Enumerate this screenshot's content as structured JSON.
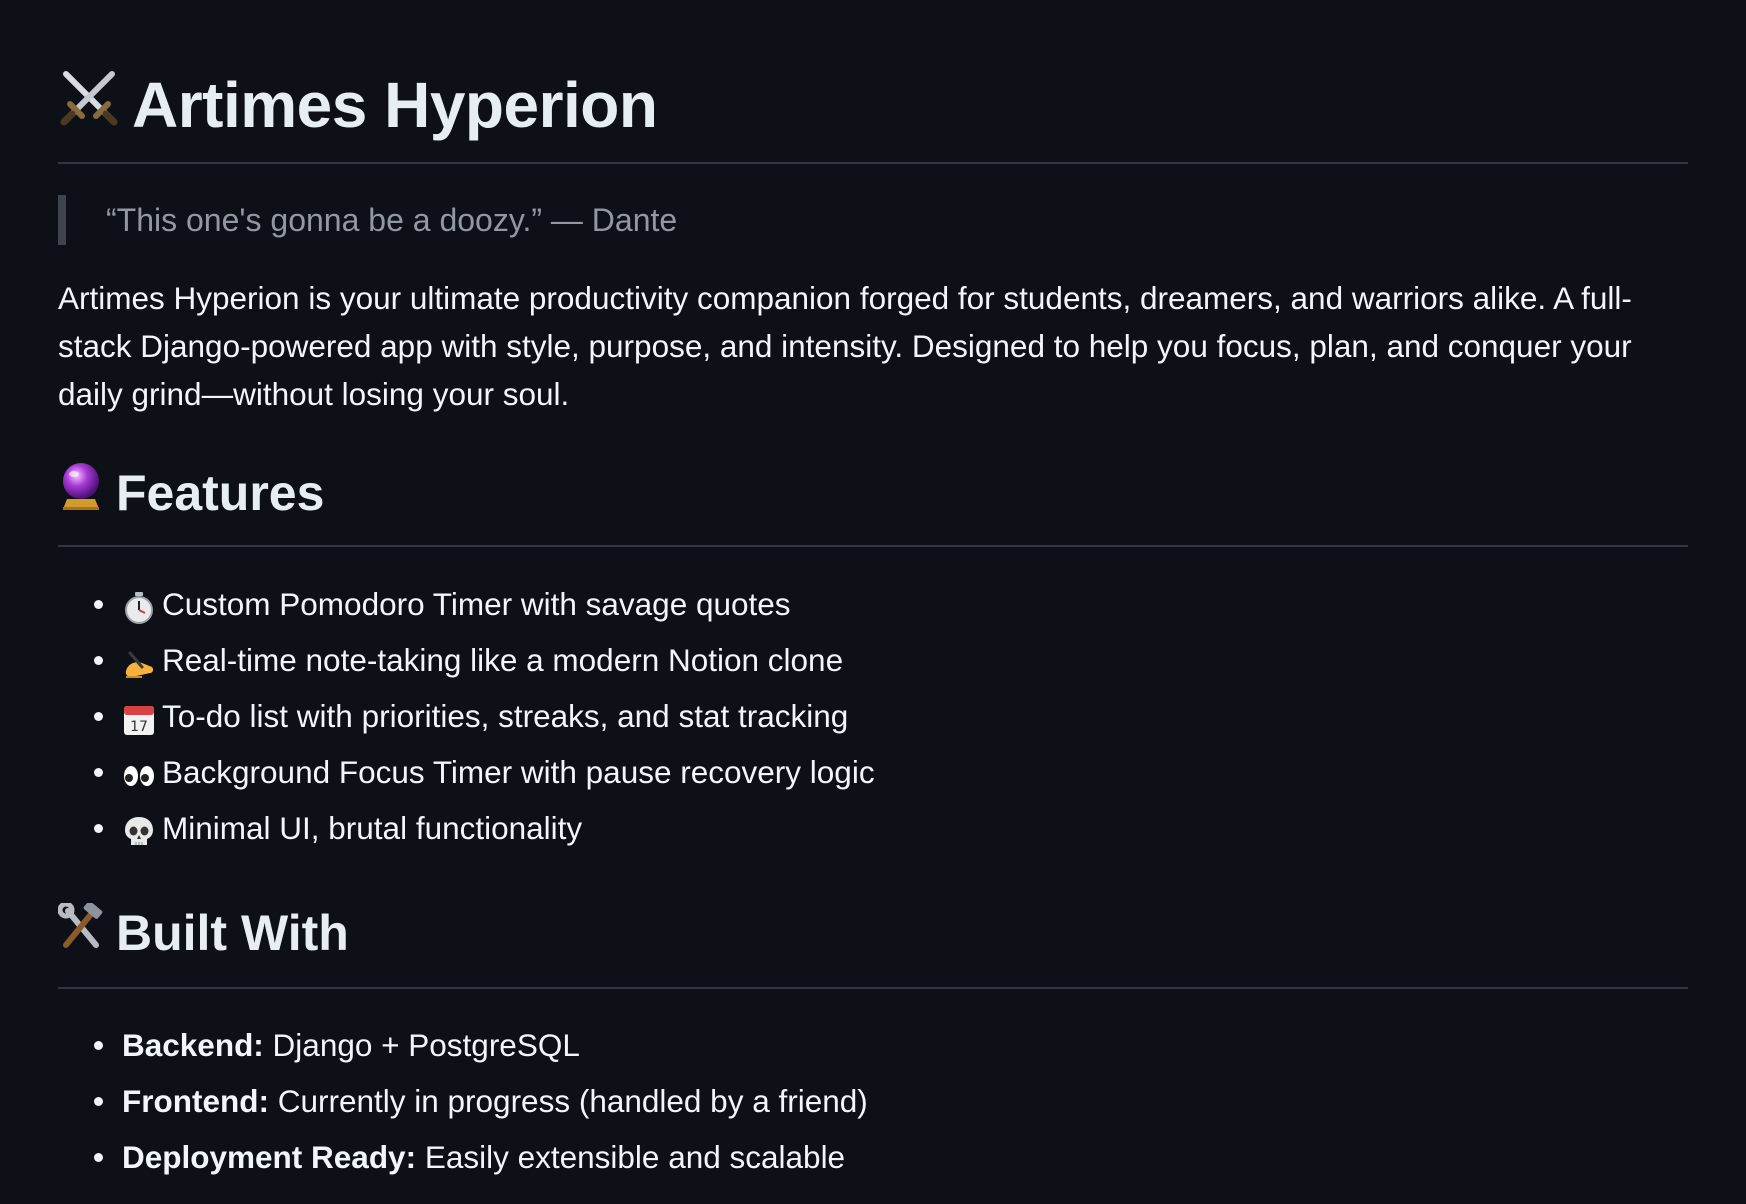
{
  "title": "Artimes Hyperion",
  "quote": "“This one's gonna be a doozy.” — Dante",
  "description": "Artimes Hyperion is your ultimate productivity companion forged for students, dreamers, and warriors alike. A full-stack Django-powered app with style, purpose, and intensity. Designed to help you focus, plan, and conquer your daily grind—without losing your soul.",
  "icons": {
    "title": "crossed-swords-icon",
    "features": "crystal-ball-icon",
    "built_with": "hammer-and-wrench-icon"
  },
  "features": {
    "heading": "Features",
    "items": [
      {
        "icon": "stopwatch-icon",
        "text": "Custom Pomodoro Timer with savage quotes"
      },
      {
        "icon": "writing-hand-icon",
        "text": "Real-time note-taking like a modern Notion clone"
      },
      {
        "icon": "calendar-icon",
        "text": "To-do list with priorities, streaks, and stat tracking"
      },
      {
        "icon": "eyes-icon",
        "text": "Background Focus Timer with pause recovery logic"
      },
      {
        "icon": "skull-icon",
        "text": "Minimal UI, brutal functionality"
      }
    ]
  },
  "built_with": {
    "heading": "Built With",
    "items": [
      {
        "label": "Backend:",
        "value": " Django + PostgreSQL"
      },
      {
        "label": "Frontend:",
        "value": " Currently in progress (handled by a friend)"
      },
      {
        "label": "Deployment Ready:",
        "value": " Easily extensible and scalable"
      }
    ]
  },
  "colors": {
    "background": "#0d1117",
    "text": "#f0f6fc",
    "muted": "#9198a1",
    "divider": "#30363d"
  }
}
